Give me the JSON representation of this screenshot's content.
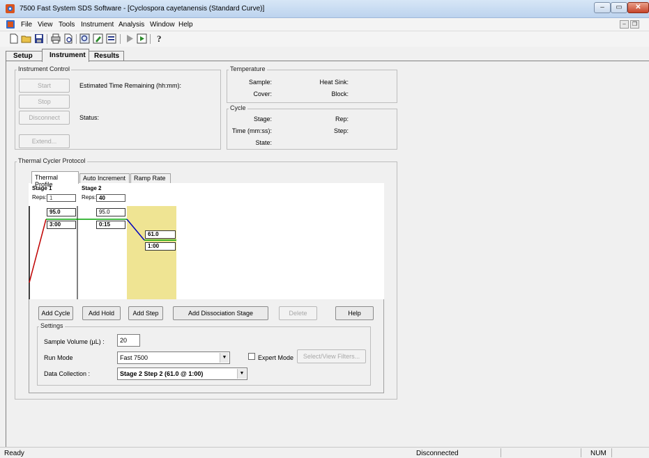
{
  "window": {
    "title": "7500 Fast System SDS Software - [Cyclospora cayetanensis (Standard Curve)]",
    "controls": {
      "minimize": "–",
      "maximize": "▭",
      "close": "✕"
    }
  },
  "menu": {
    "items": [
      "File",
      "View",
      "Tools",
      "Instrument",
      "Analysis",
      "Window",
      "Help"
    ],
    "mdi": {
      "minimize": "–",
      "restore": "❐"
    }
  },
  "toolbar": {
    "icons": [
      "new-icon",
      "open-icon",
      "save-icon",
      "print-icon",
      "print-preview-icon",
      "zoom-icon",
      "edit-icon",
      "grid-icon",
      "play-icon",
      "run-icon",
      "help-icon"
    ]
  },
  "main_tabs": [
    {
      "label": "Setup"
    },
    {
      "label": "Instrument"
    },
    {
      "label": "Results"
    }
  ],
  "instrument_control": {
    "title": "Instrument Control",
    "start": "Start",
    "stop": "Stop",
    "disconnect": "Disconnect",
    "extend": "Extend...",
    "time_remaining_label": "Estimated Time Remaining (hh:mm):",
    "status_label": "Status:"
  },
  "temperature": {
    "title": "Temperature",
    "sample": "Sample:",
    "cover": "Cover:",
    "heat_sink": "Heat Sink:",
    "block": "Block:"
  },
  "cycle": {
    "title": "Cycle",
    "stage": "Stage:",
    "time": "Time (mm:ss):",
    "state": "State:",
    "rep": "Rep:",
    "step": "Step:"
  },
  "protocol": {
    "title": "Thermal Cycler Protocol",
    "tabs": [
      {
        "label": "Thermal Profile"
      },
      {
        "label": "Auto Increment"
      },
      {
        "label": "Ramp Rate"
      }
    ],
    "stages": [
      {
        "name": "Stage 1",
        "reps_label": "Reps:",
        "reps": "1",
        "steps": [
          {
            "temp": "95.0",
            "time": "3:00"
          }
        ]
      },
      {
        "name": "Stage 2",
        "reps_label": "Reps:",
        "reps": "40",
        "steps": [
          {
            "temp": "95.0",
            "time": "0:15"
          },
          {
            "temp": "61.0",
            "time": "1:00"
          }
        ]
      }
    ],
    "colors": {
      "ramp_up": "#c00000",
      "hold": "#00a000",
      "ramp_down": "#0000c0",
      "highlight": "#efe493"
    }
  },
  "buttons": {
    "add_cycle": "Add Cycle",
    "add_hold": "Add Hold",
    "add_step": "Add Step",
    "add_dissociation": "Add Dissociation Stage",
    "delete": "Delete",
    "help": "Help"
  },
  "settings": {
    "title": "Settings",
    "sample_volume_label": "Sample Volume (µL) :",
    "sample_volume": "20",
    "run_mode_label": "Run Mode",
    "run_mode": "Fast 7500",
    "expert_mode_label": "Expert Mode",
    "select_filters": "Select/View Filters...",
    "data_collection_label": "Data Collection :",
    "data_collection": "Stage 2 Step 2 (61.0 @ 1:00)"
  },
  "statusbar": {
    "left": "Ready",
    "connection": "Disconnected",
    "num": "NUM"
  }
}
